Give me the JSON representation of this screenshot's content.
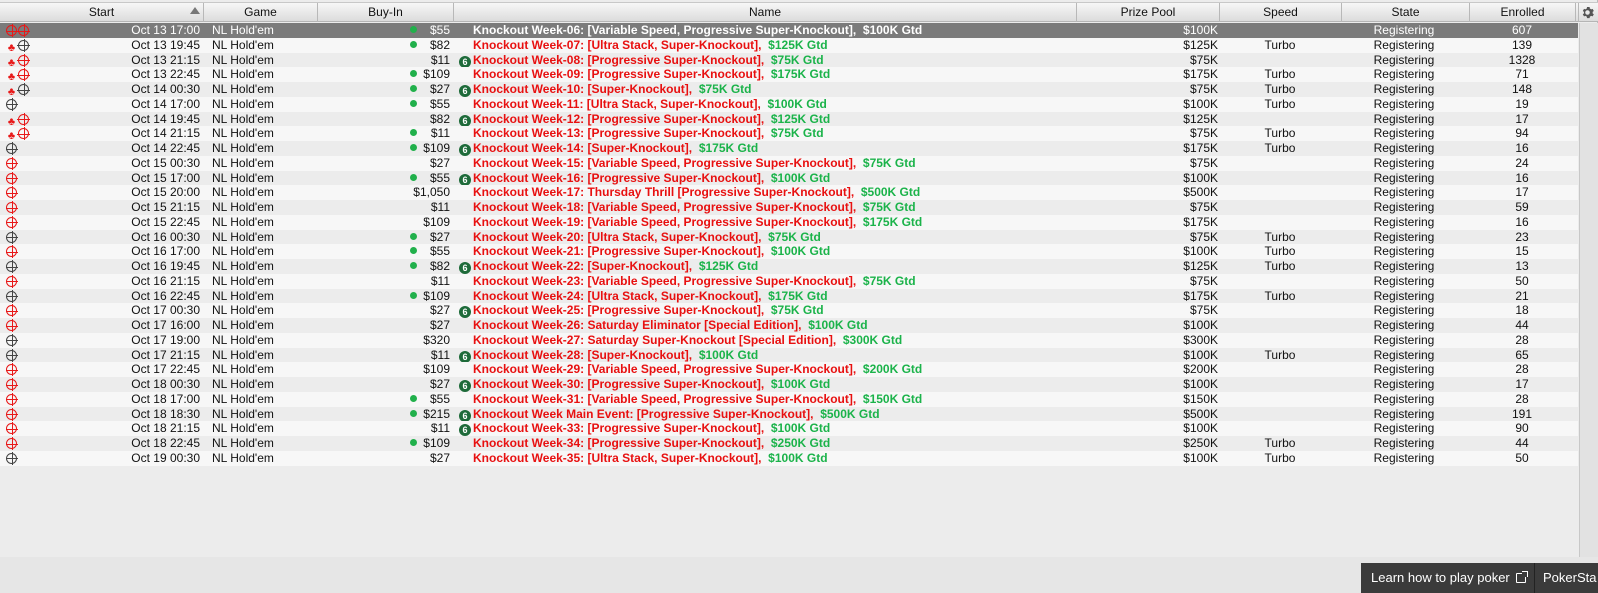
{
  "columns": {
    "start": "Start",
    "game": "Game",
    "buyin": "Buy-In",
    "name": "Name",
    "prize": "Prize Pool",
    "speed": "Speed",
    "state": "State",
    "enrolled": "Enrolled"
  },
  "footer": {
    "learn_link": "Learn how to play poker",
    "brand_tab": "PokerSta"
  },
  "rows": [
    {
      "icons": [
        "tgt-red",
        "tgt-red"
      ],
      "start": "Oct 13  17:00",
      "game": "NL Hold'em",
      "dot": true,
      "buyin": "$55",
      "ann": false,
      "name_red": "Knockout Week-06: [Variable Speed, Progressive Super-Knockout],",
      "name_green": "$100K Gtd",
      "prize": "$100K",
      "speed": "",
      "state": "Registering",
      "enrolled": "607",
      "selected": true
    },
    {
      "icons": [
        "spade",
        "tgt-grey"
      ],
      "start": "Oct 13  19:45",
      "game": "NL Hold'em",
      "dot": true,
      "buyin": "$82",
      "ann": false,
      "name_red": "Knockout Week-07: [Ultra Stack, Super-Knockout],",
      "name_green": "$125K Gtd",
      "prize": "$125K",
      "speed": "Turbo",
      "state": "Registering",
      "enrolled": "139"
    },
    {
      "icons": [
        "spade",
        "tgt-red"
      ],
      "start": "Oct 13  21:15",
      "game": "NL Hold'em",
      "dot": false,
      "buyin": "$11",
      "ann": true,
      "name_red": "Knockout Week-08: [Progressive Super-Knockout],",
      "name_green": "$75K Gtd",
      "prize": "$75K",
      "speed": "",
      "state": "Registering",
      "enrolled": "1328"
    },
    {
      "icons": [
        "spade",
        "tgt-red"
      ],
      "start": "Oct 13  22:45",
      "game": "NL Hold'em",
      "dot": true,
      "buyin": "$109",
      "ann": false,
      "name_red": "Knockout Week-09: [Progressive Super-Knockout],",
      "name_green": "$175K Gtd",
      "prize": "$175K",
      "speed": "Turbo",
      "state": "Registering",
      "enrolled": "71"
    },
    {
      "icons": [
        "spade",
        "tgt-grey"
      ],
      "start": "Oct 14  00:30",
      "game": "NL Hold'em",
      "dot": true,
      "buyin": "$27",
      "ann": true,
      "name_red": "Knockout Week-10: [Super-Knockout],",
      "name_green": "$75K Gtd",
      "prize": "$75K",
      "speed": "Turbo",
      "state": "Registering",
      "enrolled": "148"
    },
    {
      "icons": [
        "tgt-grey"
      ],
      "start": "Oct 14  17:00",
      "game": "NL Hold'em",
      "dot": true,
      "buyin": "$55",
      "ann": false,
      "name_red": "Knockout Week-11: [Ultra Stack, Super-Knockout],",
      "name_green": "$100K Gtd",
      "prize": "$100K",
      "speed": "Turbo",
      "state": "Registering",
      "enrolled": "19"
    },
    {
      "icons": [
        "spade",
        "tgt-red"
      ],
      "start": "Oct 14  19:45",
      "game": "NL Hold'em",
      "dot": false,
      "buyin": "$82",
      "ann": true,
      "name_red": "Knockout Week-12: [Progressive Super-Knockout],",
      "name_green": "$125K Gtd",
      "prize": "$125K",
      "speed": "",
      "state": "Registering",
      "enrolled": "17"
    },
    {
      "icons": [
        "spade",
        "tgt-red"
      ],
      "start": "Oct 14  21:15",
      "game": "NL Hold'em",
      "dot": true,
      "buyin": "$11",
      "ann": false,
      "name_red": "Knockout Week-13: [Progressive Super-Knockout],",
      "name_green": "$75K Gtd",
      "prize": "$75K",
      "speed": "Turbo",
      "state": "Registering",
      "enrolled": "94"
    },
    {
      "icons": [
        "tgt-grey"
      ],
      "start": "Oct 14  22:45",
      "game": "NL Hold'em",
      "dot": true,
      "buyin": "$109",
      "ann": true,
      "name_red": "Knockout Week-14: [Super-Knockout],",
      "name_green": "$175K Gtd",
      "prize": "$175K",
      "speed": "Turbo",
      "state": "Registering",
      "enrolled": "16"
    },
    {
      "icons": [
        "tgt-red"
      ],
      "start": "Oct 15  00:30",
      "game": "NL Hold'em",
      "dot": false,
      "buyin": "$27",
      "ann": false,
      "name_red": "Knockout Week-15: [Variable Speed, Progressive Super-Knockout],",
      "name_green": "$75K Gtd",
      "prize": "$75K",
      "speed": "",
      "state": "Registering",
      "enrolled": "24"
    },
    {
      "icons": [
        "tgt-red"
      ],
      "start": "Oct 15  17:00",
      "game": "NL Hold'em",
      "dot": true,
      "buyin": "$55",
      "ann": true,
      "name_red": "Knockout Week-16: [Progressive Super-Knockout],",
      "name_green": "$100K Gtd",
      "prize": "$100K",
      "speed": "",
      "state": "Registering",
      "enrolled": "16"
    },
    {
      "icons": [
        "tgt-red"
      ],
      "start": "Oct 15  20:00",
      "game": "NL Hold'em",
      "dot": false,
      "buyin": "$1,050",
      "ann": false,
      "name_red": "Knockout Week-17: Thursday Thrill [Progressive Super-Knockout],",
      "name_green": "$500K Gtd",
      "prize": "$500K",
      "speed": "",
      "state": "Registering",
      "enrolled": "17"
    },
    {
      "icons": [
        "tgt-red"
      ],
      "start": "Oct 15  21:15",
      "game": "NL Hold'em",
      "dot": false,
      "buyin": "$11",
      "ann": false,
      "name_red": "Knockout Week-18: [Variable Speed, Progressive Super-Knockout],",
      "name_green": "$75K Gtd",
      "prize": "$75K",
      "speed": "",
      "state": "Registering",
      "enrolled": "59"
    },
    {
      "icons": [
        "tgt-red"
      ],
      "start": "Oct 15  22:45",
      "game": "NL Hold'em",
      "dot": false,
      "buyin": "$109",
      "ann": false,
      "name_red": "Knockout Week-19: [Variable Speed, Progressive Super-Knockout],",
      "name_green": "$175K Gtd",
      "prize": "$175K",
      "speed": "",
      "state": "Registering",
      "enrolled": "16"
    },
    {
      "icons": [
        "tgt-grey"
      ],
      "start": "Oct 16  00:30",
      "game": "NL Hold'em",
      "dot": true,
      "buyin": "$27",
      "ann": false,
      "name_red": "Knockout Week-20: [Ultra Stack, Super-Knockout],",
      "name_green": "$75K Gtd",
      "prize": "$75K",
      "speed": "Turbo",
      "state": "Registering",
      "enrolled": "23"
    },
    {
      "icons": [
        "tgt-red"
      ],
      "start": "Oct 16  17:00",
      "game": "NL Hold'em",
      "dot": true,
      "buyin": "$55",
      "ann": false,
      "name_red": "Knockout Week-21: [Progressive Super-Knockout],",
      "name_green": "$100K Gtd",
      "prize": "$100K",
      "speed": "Turbo",
      "state": "Registering",
      "enrolled": "15"
    },
    {
      "icons": [
        "tgt-grey"
      ],
      "start": "Oct 16  19:45",
      "game": "NL Hold'em",
      "dot": true,
      "buyin": "$82",
      "ann": true,
      "name_red": "Knockout Week-22: [Super-Knockout],",
      "name_green": "$125K Gtd",
      "prize": "$125K",
      "speed": "Turbo",
      "state": "Registering",
      "enrolled": "13"
    },
    {
      "icons": [
        "tgt-red"
      ],
      "start": "Oct 16  21:15",
      "game": "NL Hold'em",
      "dot": false,
      "buyin": "$11",
      "ann": false,
      "name_red": "Knockout Week-23: [Variable Speed, Progressive Super-Knockout],",
      "name_green": "$75K Gtd",
      "prize": "$75K",
      "speed": "",
      "state": "Registering",
      "enrolled": "50"
    },
    {
      "icons": [
        "tgt-grey"
      ],
      "start": "Oct 16  22:45",
      "game": "NL Hold'em",
      "dot": true,
      "buyin": "$109",
      "ann": false,
      "name_red": "Knockout Week-24: [Ultra Stack, Super-Knockout],",
      "name_green": "$175K Gtd",
      "prize": "$175K",
      "speed": "Turbo",
      "state": "Registering",
      "enrolled": "21"
    },
    {
      "icons": [
        "tgt-red"
      ],
      "start": "Oct 17  00:30",
      "game": "NL Hold'em",
      "dot": false,
      "buyin": "$27",
      "ann": true,
      "name_red": "Knockout Week-25: [Progressive Super-Knockout],",
      "name_green": "$75K Gtd",
      "prize": "$75K",
      "speed": "",
      "state": "Registering",
      "enrolled": "18"
    },
    {
      "icons": [
        "tgt-red"
      ],
      "start": "Oct 17  16:00",
      "game": "NL Hold'em",
      "dot": false,
      "buyin": "$27",
      "ann": false,
      "name_red": "Knockout Week-26: Saturday Eliminator [Special Edition],",
      "name_green": "$100K Gtd",
      "prize": "$100K",
      "speed": "",
      "state": "Registering",
      "enrolled": "44"
    },
    {
      "icons": [
        "tgt-grey"
      ],
      "start": "Oct 17  19:00",
      "game": "NL Hold'em",
      "dot": false,
      "buyin": "$320",
      "ann": false,
      "name_red": "Knockout Week-27: Saturday Super-Knockout [Special Edition],",
      "name_green": "$300K Gtd",
      "prize": "$300K",
      "speed": "",
      "state": "Registering",
      "enrolled": "28"
    },
    {
      "icons": [
        "tgt-grey"
      ],
      "start": "Oct 17  21:15",
      "game": "NL Hold'em",
      "dot": false,
      "buyin": "$11",
      "ann": true,
      "name_red": "Knockout Week-28: [Super-Knockout],",
      "name_green": "$100K Gtd",
      "prize": "$100K",
      "speed": "Turbo",
      "state": "Registering",
      "enrolled": "65"
    },
    {
      "icons": [
        "tgt-red"
      ],
      "start": "Oct 17  22:45",
      "game": "NL Hold'em",
      "dot": false,
      "buyin": "$109",
      "ann": false,
      "name_red": "Knockout Week-29: [Variable Speed, Progressive Super-Knockout],",
      "name_green": "$200K Gtd",
      "prize": "$200K",
      "speed": "",
      "state": "Registering",
      "enrolled": "28"
    },
    {
      "icons": [
        "tgt-red"
      ],
      "start": "Oct 18  00:30",
      "game": "NL Hold'em",
      "dot": false,
      "buyin": "$27",
      "ann": true,
      "name_red": "Knockout Week-30: [Progressive Super-Knockout],",
      "name_green": "$100K Gtd",
      "prize": "$100K",
      "speed": "",
      "state": "Registering",
      "enrolled": "17"
    },
    {
      "icons": [
        "tgt-red"
      ],
      "start": "Oct 18  17:00",
      "game": "NL Hold'em",
      "dot": true,
      "buyin": "$55",
      "ann": false,
      "name_red": "Knockout Week-31: [Variable Speed, Progressive Super-Knockout],",
      "name_green": "$150K Gtd",
      "prize": "$150K",
      "speed": "",
      "state": "Registering",
      "enrolled": "28"
    },
    {
      "icons": [
        "tgt-red"
      ],
      "start": "Oct 18  18:30",
      "game": "NL Hold'em",
      "dot": true,
      "buyin": "$215",
      "ann": true,
      "name_red": "Knockout Week Main Event: [Progressive Super-Knockout],",
      "name_green": "$500K Gtd",
      "prize": "$500K",
      "speed": "",
      "state": "Registering",
      "enrolled": "191"
    },
    {
      "icons": [
        "tgt-red"
      ],
      "start": "Oct 18  21:15",
      "game": "NL Hold'em",
      "dot": false,
      "buyin": "$11",
      "ann": true,
      "name_red": "Knockout Week-33: [Progressive Super-Knockout],",
      "name_green": "$100K Gtd",
      "prize": "$100K",
      "speed": "",
      "state": "Registering",
      "enrolled": "90"
    },
    {
      "icons": [
        "tgt-red"
      ],
      "start": "Oct 18  22:45",
      "game": "NL Hold'em",
      "dot": true,
      "buyin": "$109",
      "ann": false,
      "name_red": "Knockout Week-34: [Progressive Super-Knockout],",
      "name_green": "$250K Gtd",
      "prize": "$250K",
      "speed": "Turbo",
      "state": "Registering",
      "enrolled": "44"
    },
    {
      "icons": [
        "tgt-grey"
      ],
      "start": "Oct 19  00:30",
      "game": "NL Hold'em",
      "dot": false,
      "buyin": "$27",
      "ann": false,
      "name_red": "Knockout Week-35: [Ultra Stack, Super-Knockout],",
      "name_green": "$100K Gtd",
      "prize": "$100K",
      "speed": "Turbo",
      "state": "Registering",
      "enrolled": "50"
    }
  ]
}
